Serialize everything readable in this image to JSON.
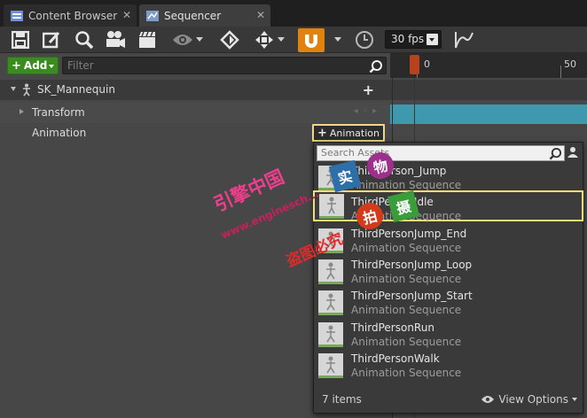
{
  "tabs": [
    {
      "label": "Content Browser",
      "icon": "content-browser-icon",
      "close": "✕"
    },
    {
      "label": "Sequencer",
      "icon": "sequencer-icon",
      "close": "✕"
    }
  ],
  "toolbar": {
    "fps_value": "30 fps",
    "snap_color": "#e2820e"
  },
  "filter_row": {
    "add_label": "Add",
    "add_plus": "+",
    "filter_placeholder": "Filter"
  },
  "outliner": {
    "actor": "SK_Mannequin",
    "actor_plus": "+",
    "transform": "Transform",
    "transform_keys": "◂ ◦ ▸",
    "animation": "Animation",
    "animation_button_plus": "+",
    "animation_button": "Animation"
  },
  "timeline": {
    "ticks": [
      "0",
      "50"
    ],
    "track_color": "#3e98ae"
  },
  "asset_picker": {
    "search_placeholder": "Search Assets",
    "items": [
      {
        "name": "ThirdPerson_Jump",
        "type": "Animation Sequence"
      },
      {
        "name": "ThirdPersonIdle",
        "type": "Animation Sequence"
      },
      {
        "name": "ThirdPersonJump_End",
        "type": "Animation Sequence"
      },
      {
        "name": "ThirdPersonJump_Loop",
        "type": "Animation Sequence"
      },
      {
        "name": "ThirdPersonJump_Start",
        "type": "Animation Sequence"
      },
      {
        "name": "ThirdPersonRun",
        "type": "Animation Sequence"
      },
      {
        "name": "ThirdPersonWalk",
        "type": "Animation Sequence"
      }
    ],
    "selected_index": 1,
    "count": "7 items",
    "view_options": "View Options"
  },
  "watermark": {
    "line1": "引擎中国",
    "url": "www.enginesch...",
    "line2": "盗图必究",
    "badges": [
      "实",
      "物",
      "拍",
      "摄"
    ]
  }
}
